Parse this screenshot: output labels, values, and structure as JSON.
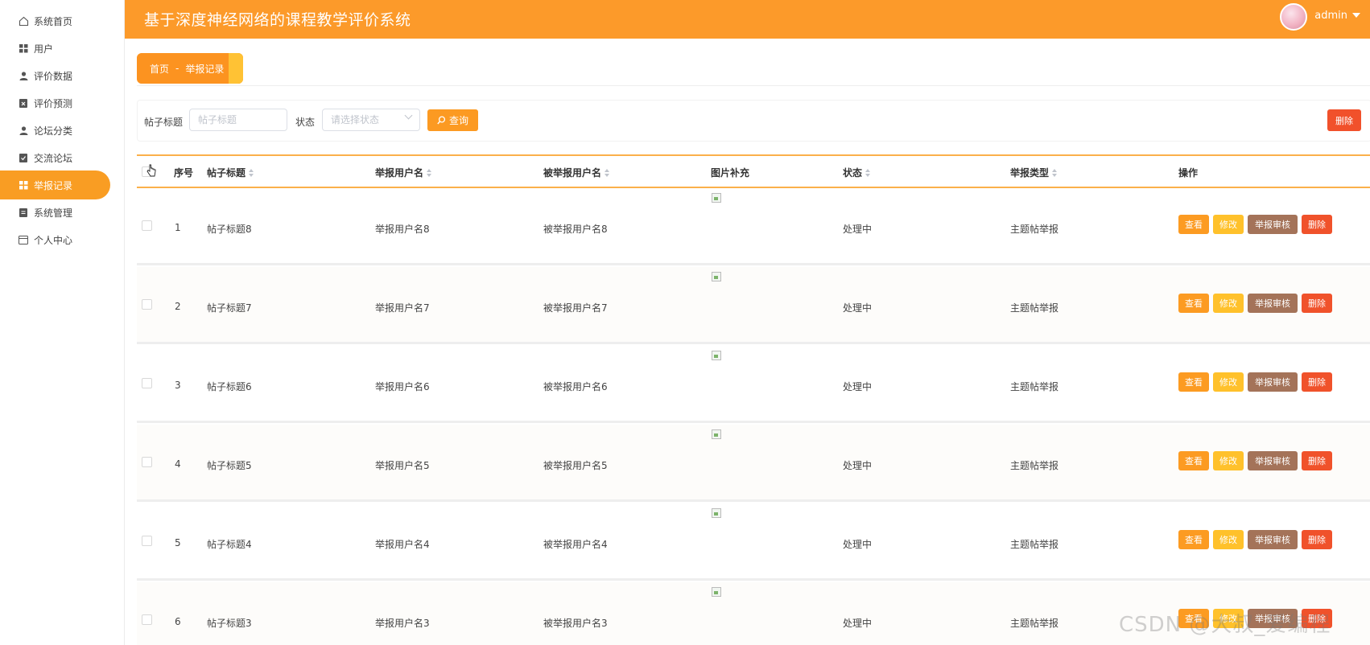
{
  "header": {
    "title": "基于深度神经网络的课程教学评价系统",
    "username": "admin"
  },
  "sidebar": {
    "items": [
      {
        "label": "系统首页",
        "icon": "home-icon"
      },
      {
        "label": "用户",
        "icon": "grid-icon"
      },
      {
        "label": "评价数据",
        "icon": "user-icon"
      },
      {
        "label": "评价预测",
        "icon": "clipboard-x-icon"
      },
      {
        "label": "论坛分类",
        "icon": "user-icon"
      },
      {
        "label": "交流论坛",
        "icon": "clipboard-check-icon"
      },
      {
        "label": "举报记录",
        "icon": "grid-icon",
        "active": true
      },
      {
        "label": "系统管理",
        "icon": "clipboard-icon"
      },
      {
        "label": "个人中心",
        "icon": "card-icon"
      }
    ]
  },
  "breadcrumb": {
    "home": "首页",
    "separator": "-",
    "current": "举报记录"
  },
  "search": {
    "title_label": "帖子标题",
    "title_placeholder": "帖子标题",
    "status_label": "状态",
    "status_placeholder": "请选择状态",
    "query_label": "查询",
    "delete_label": "删除"
  },
  "table": {
    "columns": [
      "序号",
      "帖子标题",
      "举报用户名",
      "被举报用户名",
      "图片补充",
      "状态",
      "举报类型",
      "操作"
    ],
    "rows": [
      {
        "index": "1",
        "title": "帖子标题8",
        "reporter": "举报用户名8",
        "reported": "被举报用户名8",
        "status": "处理中",
        "type": "主题帖举报"
      },
      {
        "index": "2",
        "title": "帖子标题7",
        "reporter": "举报用户名7",
        "reported": "被举报用户名7",
        "status": "处理中",
        "type": "主题帖举报"
      },
      {
        "index": "3",
        "title": "帖子标题6",
        "reporter": "举报用户名6",
        "reported": "被举报用户名6",
        "status": "处理中",
        "type": "主题帖举报"
      },
      {
        "index": "4",
        "title": "帖子标题5",
        "reporter": "举报用户名5",
        "reported": "被举报用户名5",
        "status": "处理中",
        "type": "主题帖举报"
      },
      {
        "index": "5",
        "title": "帖子标题4",
        "reporter": "举报用户名4",
        "reported": "被举报用户名4",
        "status": "处理中",
        "type": "主题帖举报"
      },
      {
        "index": "6",
        "title": "帖子标题3",
        "reporter": "举报用户名3",
        "reported": "被举报用户名3",
        "status": "处理中",
        "type": "主题帖举报"
      }
    ],
    "actions": {
      "view": "查看",
      "edit": "修改",
      "audit": "举报审核",
      "delete": "删除"
    }
  },
  "watermark": "CSDN @大叔_爱编程",
  "colors": {
    "primary": "#fc9a2a",
    "edit": "#ffc12b",
    "audit": "#a47359",
    "danger": "#f0522b"
  }
}
